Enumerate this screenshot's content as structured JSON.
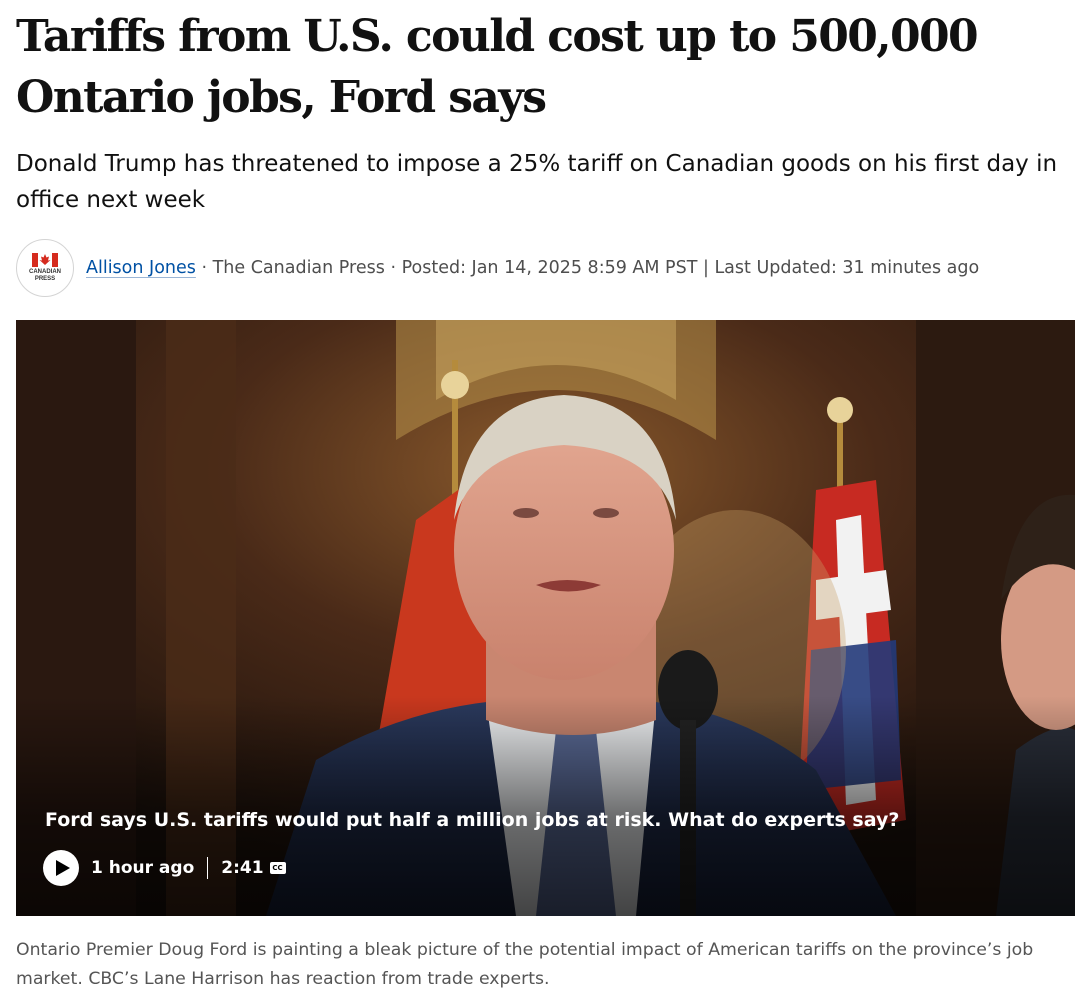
{
  "article": {
    "headline": "Tariffs from U.S. could cost up to 500,000 Ontario jobs, Ford says",
    "deck": "Donald Trump has threatened to impose a 25% tariff on Canadian goods on his first day in office next week",
    "byline": {
      "logo_text": "CANADIAN PRESS",
      "author": "Allison Jones",
      "separator": " · ",
      "source": "The Canadian Press",
      "posted": "Posted: Jan 14, 2025 8:59 AM PST",
      "divider": " | ",
      "updated": "Last Updated: 31 minutes ago"
    }
  },
  "video": {
    "title": "Ford says U.S. tariffs would put half a million jobs at risk. What do experts say?",
    "time_ago": "1 hour ago",
    "duration": "2:41",
    "cc_label": "CC",
    "play_icon": "play-icon"
  },
  "caption": "Ontario Premier Doug Ford is painting a bleak picture of the potential impact of American tariffs on the province’s job market. CBC’s Lane Harrison has reaction from trade experts."
}
